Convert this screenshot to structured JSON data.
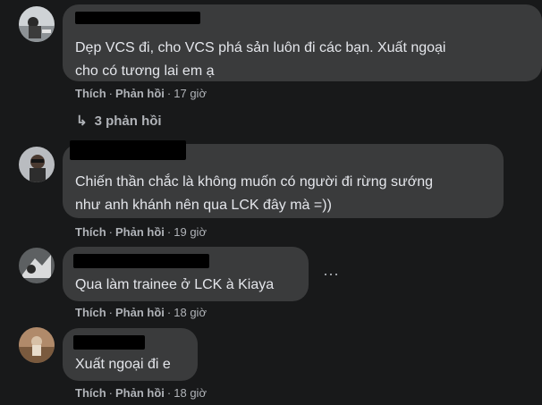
{
  "comments": [
    {
      "lines": [
        "Dẹp VCS đi, cho VCS phá sản luôn đi các bạn. Xuất ngoại",
        "cho có tương lai em ạ"
      ],
      "like": "Thích",
      "reply": "Phản hồi",
      "sep": "·",
      "time": "17 giờ"
    },
    {
      "lines": [
        "Chiến thần chắc là không muốn có người đi rừng sướng",
        "như anh khánh nên qua LCK đây mà =))"
      ],
      "like": "Thích",
      "reply": "Phản hồi",
      "sep": "·",
      "time": "19 giờ"
    },
    {
      "lines": [
        "Qua làm trainee ở LCK à Kiaya"
      ],
      "like": "Thích",
      "reply": "Phản hồi",
      "sep": "·",
      "time": "18 giờ"
    },
    {
      "lines": [
        "Xuất ngoại đi e"
      ],
      "like": "Thích",
      "reply": "Phản hồi",
      "sep": "·",
      "time": "18 giờ"
    }
  ],
  "replies_link": {
    "arrow": "↳",
    "label": "3 phản hồi"
  },
  "more_glyph": "···",
  "colors": {
    "background": "#18191a",
    "bubble": "#3a3b3c",
    "text": "#e4e6eb",
    "muted": "#b0b3b8"
  }
}
